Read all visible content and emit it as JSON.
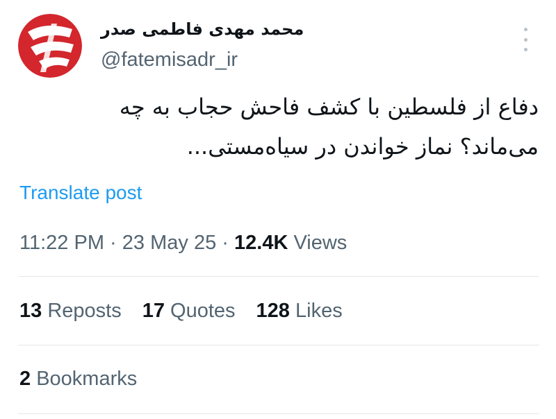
{
  "author": {
    "display_name": "محمد مهدی فاطمی صدر",
    "handle": "@fatemisadr_ir",
    "avatar_icon": "red-logo-avatar"
  },
  "menu": {
    "icon": "more-vertical-icon"
  },
  "tweet": {
    "text": "دفاع از فلسطین با کشف فاحش حجاب به چه می‌ماند؟ نماز خواندن در سیاه‌مستی...",
    "translate_label": "Translate post"
  },
  "meta": {
    "time": "11:22 PM",
    "separator": "·",
    "date": "23 May 25",
    "views_count": "12.4K",
    "views_label": "Views"
  },
  "stats": {
    "reposts_count": "13",
    "reposts_label": "Reposts",
    "quotes_count": "17",
    "quotes_label": "Quotes",
    "likes_count": "128",
    "likes_label": "Likes",
    "bookmarks_count": "2",
    "bookmarks_label": "Bookmarks"
  },
  "colors": {
    "link": "#1d9bf0",
    "secondary_text": "#536471",
    "primary_text": "#0f1419",
    "avatar_red": "#d3262d",
    "divider": "#e3e7ea"
  }
}
